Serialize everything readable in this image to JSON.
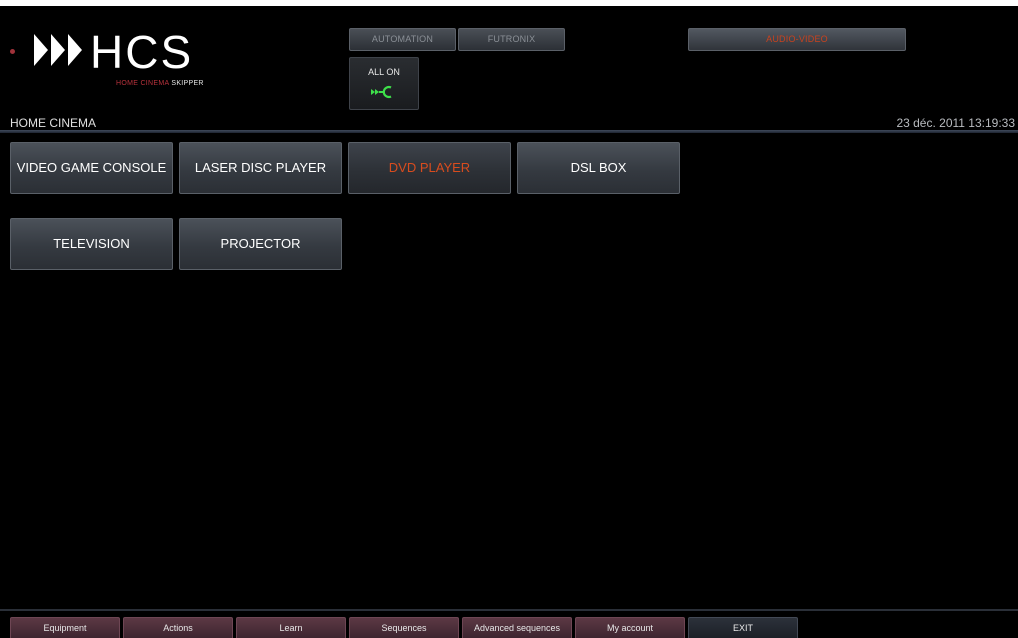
{
  "brand": {
    "logo_text": "HCS",
    "tagline_red": "HOME CINEMA",
    "tagline_white": "SKIPPER"
  },
  "top_tabs": {
    "automation": "AUTOMATION",
    "futronix": "FUTRONIX",
    "audio_video": "AUDIO-VIDEO"
  },
  "all_on": {
    "label": "ALL ON",
    "icon": "power-plug-icon"
  },
  "header": {
    "section_title": "HOME CINEMA",
    "datetime": "23 déc. 2011  13:19:33"
  },
  "devices": [
    {
      "label": "VIDEO GAME CONSOLE",
      "active": false
    },
    {
      "label": "LASER DISC PLAYER",
      "active": false
    },
    {
      "label": "DVD PLAYER",
      "active": true
    },
    {
      "label": "DSL BOX",
      "active": false
    },
    {
      "label": "TELEVISION",
      "active": false
    },
    {
      "label": "PROJECTOR",
      "active": false
    }
  ],
  "bottom_nav": {
    "equipment": "Equipment",
    "actions": "Actions",
    "learn": "Learn",
    "sequences": "Sequences",
    "advanced_sequences": "Advanced sequences",
    "my_account": "My account",
    "exit": "EXIT"
  },
  "colors": {
    "accent_active": "#d84c1e",
    "allon_icon": "#3ee04a",
    "logo_red": "#b8323c"
  }
}
